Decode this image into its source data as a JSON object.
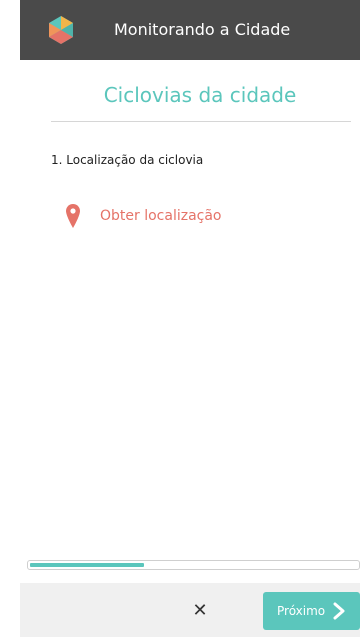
{
  "app_bar": {
    "title": "Monitorando a Cidade",
    "logo_icon": "hexagon-logo-icon",
    "background": "#4a4a4a"
  },
  "page": {
    "title": "Ciclovias da cidade",
    "title_color": "#5bc6bc"
  },
  "question": {
    "label": "1. Localização da ciclovia",
    "action_label": "Obter localização",
    "action_icon": "map-pin-icon",
    "action_color": "#e57368"
  },
  "progress": {
    "fraction": 0.35,
    "color": "#5bc6bc"
  },
  "footer": {
    "close_glyph": "✕",
    "close_icon": "close-icon",
    "next_label": "Próximo",
    "next_icon": "chevron-right-icon",
    "next_color": "#5bc6bc"
  }
}
